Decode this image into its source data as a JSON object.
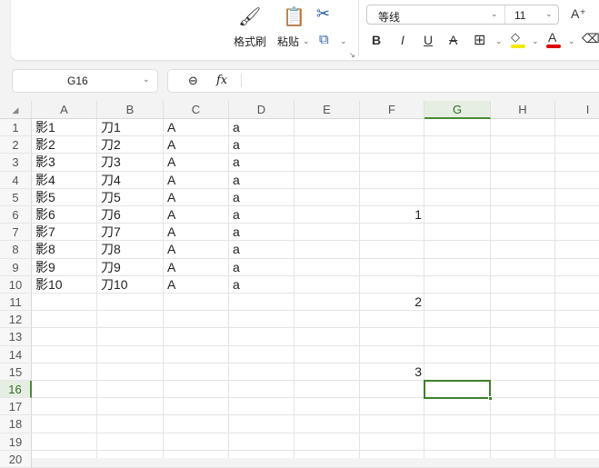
{
  "ribbon": {
    "format_painter": "格式刷",
    "paste": "粘贴",
    "font_name": "等线",
    "font_size": "11",
    "bold": "B",
    "italic": "I",
    "underline": "U",
    "strike": "A",
    "font_color": "A",
    "grow": "A⁺",
    "fill_color": "#f5e800",
    "text_color": "#e00000"
  },
  "formula_bar": {
    "name_box": "G16",
    "fx": "fx",
    "value": ""
  },
  "sheet": {
    "columns": [
      "A",
      "B",
      "C",
      "D",
      "E",
      "F",
      "G",
      "H",
      "I"
    ],
    "selected_column": "G",
    "selected_row": 16,
    "rows": [
      "1",
      "2",
      "3",
      "4",
      "5",
      "6",
      "7",
      "8",
      "9",
      "10",
      "11",
      "12",
      "13",
      "14",
      "15",
      "16",
      "17",
      "18",
      "19",
      "20"
    ],
    "data": [
      [
        "影1",
        "刀1",
        "A",
        "a"
      ],
      [
        "影2",
        "刀2",
        "A",
        "a"
      ],
      [
        "影3",
        "刀3",
        "A",
        "a"
      ],
      [
        "影4",
        "刀4",
        "A",
        "a"
      ],
      [
        "影5",
        "刀5",
        "A",
        "a"
      ],
      [
        "影6",
        "刀6",
        "A",
        "a"
      ],
      [
        "影7",
        "刀7",
        "A",
        "a"
      ],
      [
        "影8",
        "刀8",
        "A",
        "a"
      ],
      [
        "影9",
        "刀9",
        "A",
        "a"
      ],
      [
        "影10",
        "刀10",
        "A",
        "a"
      ]
    ],
    "f_values": [
      {
        "row": 6,
        "value": "1"
      },
      {
        "row": 11,
        "value": "2"
      },
      {
        "row": 15,
        "value": "3"
      }
    ]
  }
}
